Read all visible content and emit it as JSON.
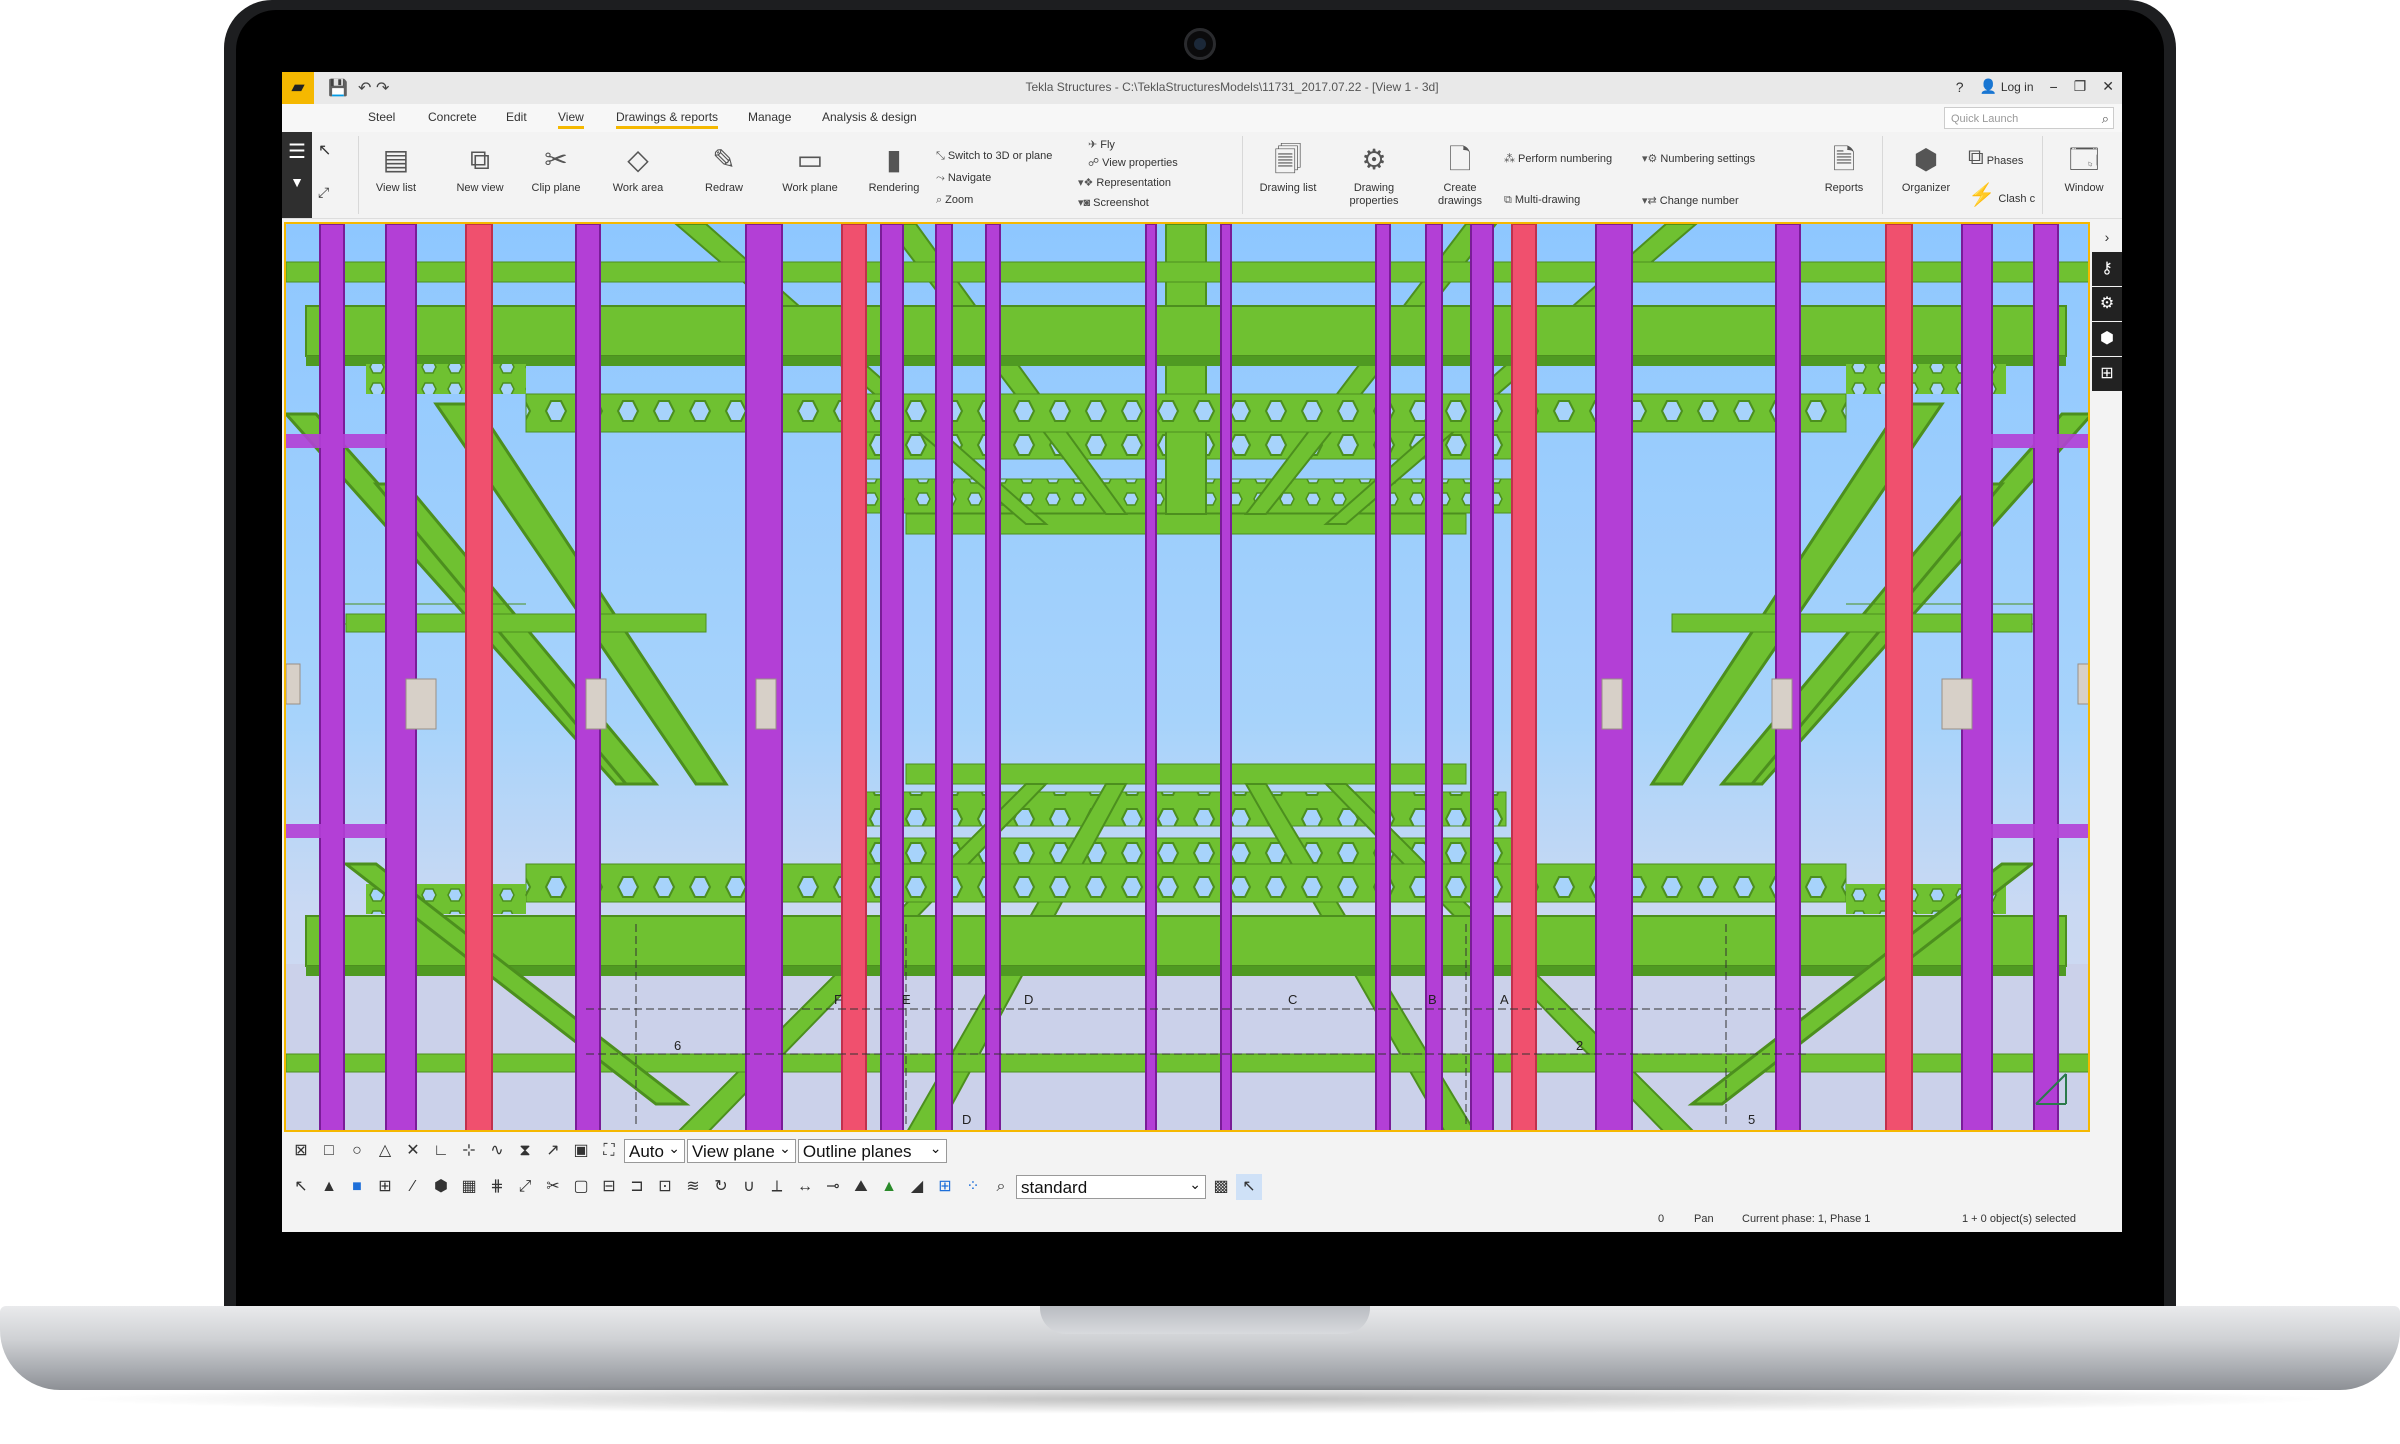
{
  "app": {
    "title": "Tekla Structures - C:\\TeklaStructuresModels\\11731_2017.07.22 - [View 1 - 3d]",
    "login": "Log in",
    "window_controls": [
      "?",
      "−",
      "❐",
      "✕"
    ]
  },
  "menu": {
    "tabs": [
      "Steel",
      "Concrete",
      "Edit",
      "View",
      "Drawings & reports",
      "Manage",
      "Analysis & design"
    ],
    "active": "View",
    "quick_launch_placeholder": "Quick Launch"
  },
  "ribbon": {
    "view_list": "View list",
    "new_view": "New view",
    "clip_plane": "Clip plane",
    "work_area": "Work area",
    "redraw": "Redraw",
    "work_plane": "Work plane",
    "rendering": "Rendering",
    "switch_3d": "Switch to 3D or plane",
    "navigate": "Navigate",
    "zoom": "Zoom",
    "fly": "Fly",
    "view_properties": "View properties",
    "representation": "Representation",
    "screenshot": "Screenshot",
    "drawing_list": "Drawing list",
    "drawing_properties": "Drawing properties",
    "create_drawings": "Create drawings",
    "perform_numbering": "Perform numbering",
    "multi_drawing": "Multi-drawing",
    "numbering_settings": "Numbering settings",
    "change_number": "Change number",
    "reports": "Reports",
    "organizer": "Organizer",
    "phases": "Phases",
    "clash": "Clash c",
    "window": "Window"
  },
  "bottom_toolbar": {
    "select_auto": "Auto",
    "select_plane": "View plane",
    "select_outline": "Outline planes",
    "select_standard": "standard"
  },
  "statusbar": {
    "count": "0",
    "mode": "Pan",
    "phase": "Current phase: 1, Phase 1",
    "selected": "1 + 0 object(s) selected"
  },
  "grid_labels": [
    "F",
    "E",
    "D",
    "C",
    "B",
    "A",
    "D",
    "5",
    "6",
    "2"
  ],
  "colors": {
    "accent": "#f5b800",
    "beam_green": "#6fc131",
    "column_purple": "#b33fd6",
    "column_red": "#f0506e",
    "sky": "#9fd0ff"
  }
}
